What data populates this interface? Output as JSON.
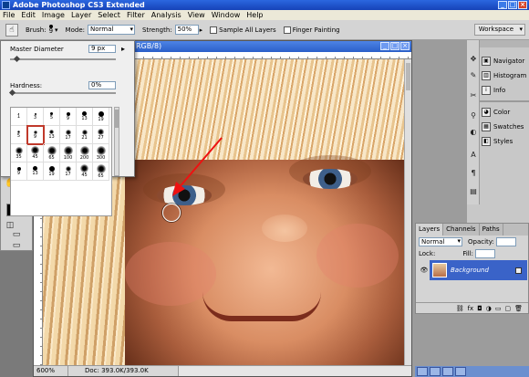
{
  "app": {
    "title": "Adobe Photoshop CS3 Extended"
  },
  "menu": [
    "File",
    "Edit",
    "Image",
    "Layer",
    "Select",
    "Filter",
    "Analysis",
    "View",
    "Window",
    "Help"
  ],
  "options": {
    "brush_label": "Brush:",
    "brush_size": "9",
    "mode_label": "Mode:",
    "mode_value": "Normal",
    "strength_label": "Strength:",
    "strength_value": "50%",
    "sample_all_layers": "Sample All Layers",
    "finger_painting": "Finger Painting",
    "workspace": "Workspace"
  },
  "document": {
    "title_fragment": "RGB/8)",
    "zoom": "600%",
    "doc_info": "Doc: 393.0K/393.0K"
  },
  "brush_picker": {
    "master_diameter_label": "Master Diameter",
    "master_diameter_value": "9 px",
    "master_diameter_fraction": 0.04,
    "hardness_label": "Hardness:",
    "hardness_value": "0%",
    "hardness_fraction": 0.0,
    "brushes": [
      {
        "size": "1",
        "kind": "hard"
      },
      {
        "size": "3",
        "kind": "hard"
      },
      {
        "size": "5",
        "kind": "hard"
      },
      {
        "size": "9",
        "kind": "hard"
      },
      {
        "size": "13",
        "kind": "hard"
      },
      {
        "size": "19",
        "kind": "hard"
      },
      {
        "size": "5",
        "kind": "soft"
      },
      {
        "size": "9",
        "kind": "soft"
      },
      {
        "size": "13",
        "kind": "soft"
      },
      {
        "size": "17",
        "kind": "soft"
      },
      {
        "size": "21",
        "kind": "soft"
      },
      {
        "size": "27",
        "kind": "soft"
      },
      {
        "size": "35",
        "kind": "soft"
      },
      {
        "size": "45",
        "kind": "soft"
      },
      {
        "size": "65",
        "kind": "soft"
      },
      {
        "size": "100",
        "kind": "soft"
      },
      {
        "size": "200",
        "kind": "soft"
      },
      {
        "size": "300",
        "kind": "soft"
      },
      {
        "size": "9",
        "kind": "hard"
      },
      {
        "size": "13",
        "kind": "hard"
      },
      {
        "size": "19",
        "kind": "hard"
      },
      {
        "size": "17",
        "kind": "soft"
      },
      {
        "size": "45",
        "kind": "soft"
      },
      {
        "size": "65",
        "kind": "soft"
      }
    ],
    "selected_index": 7
  },
  "dock": {
    "items": [
      "Navigator",
      "Histogram",
      "Info",
      "Color",
      "Swatches",
      "Styles"
    ]
  },
  "layers": {
    "tabs": [
      "Layers",
      "Channels",
      "Paths"
    ],
    "active_tab": "Layers",
    "blend_mode": "Normal",
    "opacity_label": "Opacity:",
    "lock_label": "Lock:",
    "fill_label": "Fill:",
    "layer_name": "Background"
  }
}
